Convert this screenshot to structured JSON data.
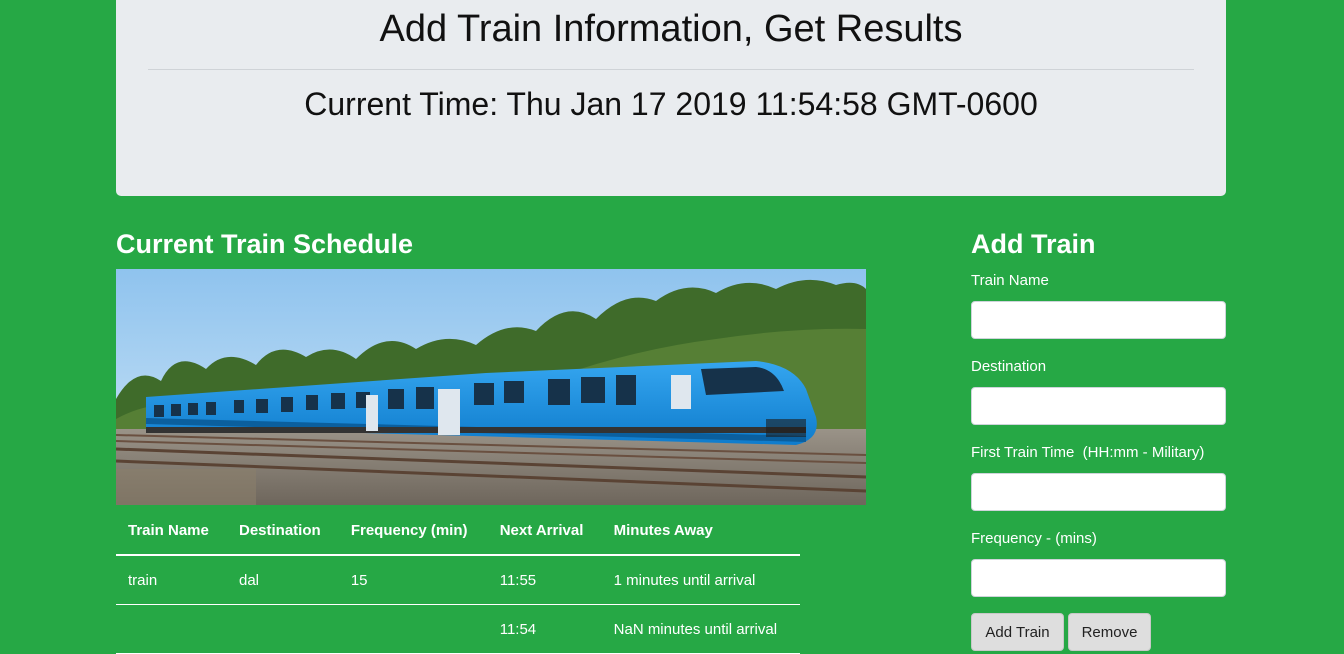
{
  "header": {
    "title": "Add Train Information, Get Results",
    "current_time": "Current Time: Thu Jan 17 2019 11:54:58 GMT-0600"
  },
  "schedule": {
    "title": "Current Train Schedule",
    "columns": [
      "Train Name",
      "Destination",
      "Frequency (min)",
      "Next Arrival",
      "Minutes Away"
    ],
    "rows": [
      [
        "train",
        "dal",
        "15",
        "11:55",
        "1 minutes until arrival"
      ],
      [
        "",
        "",
        "",
        "11:54",
        "NaN minutes until arrival"
      ]
    ]
  },
  "form": {
    "title": "Add Train",
    "train_name_label": "Train Name",
    "destination_label": "Destination",
    "first_time_label": "First Train Time  (HH:mm - Military)",
    "frequency_label": "Frequency - (mins)",
    "train_name_value": "",
    "destination_value": "",
    "first_time_value": "",
    "frequency_value": "",
    "add_button": "Add Train",
    "remove_button": "Remove"
  },
  "colors": {
    "page_background": "#26a845",
    "jumbotron_background": "#e9ecef",
    "train_body": "#1b8fe3"
  }
}
